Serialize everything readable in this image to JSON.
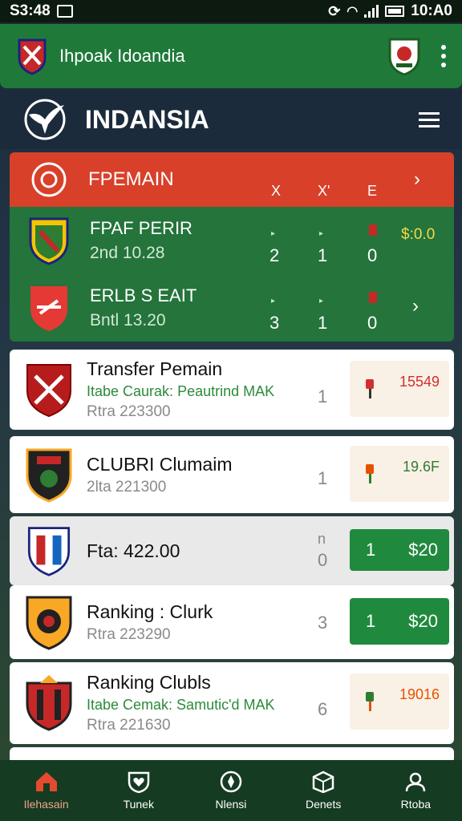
{
  "status_bar": {
    "time_left": "S3:48",
    "time_right": "10:A0"
  },
  "app_bar": {
    "title": "Ihpoak Idoandia"
  },
  "brand": {
    "name": "INDANSIA"
  },
  "matches": {
    "title": "FPEMAIN",
    "columns": [
      "X",
      "X'",
      "E"
    ],
    "rows": [
      {
        "name": "FPAF PERIR",
        "date": "2nd 10.28",
        "scores": [
          "2",
          "1",
          "0"
        ],
        "odds": "$:0.0"
      },
      {
        "name": "ERLB S EAIT",
        "date": "Bntl 13.20",
        "scores": [
          "3",
          "1",
          "0"
        ],
        "odds": ""
      }
    ]
  },
  "cards": [
    {
      "title": "Transfer Pemain",
      "sub": "Itabe Caurak: Peautrind MAK",
      "meta": "Rtra 223300",
      "rank": "1",
      "box": "odd",
      "value": "15549",
      "color": "#d32f2f"
    },
    {
      "title": "CLUBRI Clumaim",
      "sub": "",
      "meta": "2lta 221300",
      "rank": "1",
      "box": "odd",
      "value": "19.6F",
      "color": "#2e7d32"
    },
    {
      "title": "Fta: 422.00",
      "sub": "",
      "meta": "",
      "rank": "0",
      "rank_top": "n",
      "box": "green",
      "num": "1",
      "amount": "$20"
    },
    {
      "title": "Ranking : Clurk",
      "sub": "",
      "meta": "Rtra 223290",
      "rank": "3",
      "box": "green",
      "num": "1",
      "amount": "$20"
    },
    {
      "title": "Ranking Clubls",
      "sub": "Itabe Cemak: Samutic'd MAK",
      "meta": "Rtra 221630",
      "rank": "6",
      "box": "odd",
      "value": "19016",
      "color": "#e65100"
    }
  ],
  "bottom_nav": [
    {
      "label": "Ilehasain",
      "icon": "home-icon"
    },
    {
      "label": "Tunek",
      "icon": "heart-shield-icon"
    },
    {
      "label": "Nlensi",
      "icon": "compass-icon"
    },
    {
      "label": "Denets",
      "icon": "box-icon"
    },
    {
      "label": "Rtoba",
      "icon": "profile-icon"
    }
  ]
}
